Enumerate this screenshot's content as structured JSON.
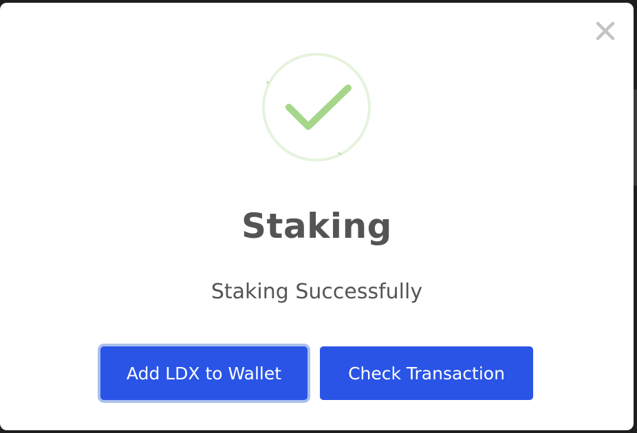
{
  "dialog": {
    "title": "Staking",
    "message": "Staking Successfully",
    "status_icon": "checkmark-success-icon",
    "close_icon": "close-icon"
  },
  "buttons": {
    "add_wallet_label": "Add LDX to Wallet",
    "check_transaction_label": "Check Transaction"
  },
  "colors": {
    "primary": "#2a54e6",
    "success": "#a5d68a",
    "success_ring": "#e5f3dc",
    "text": "#545454",
    "focus_ring": "#a9c0ec"
  }
}
